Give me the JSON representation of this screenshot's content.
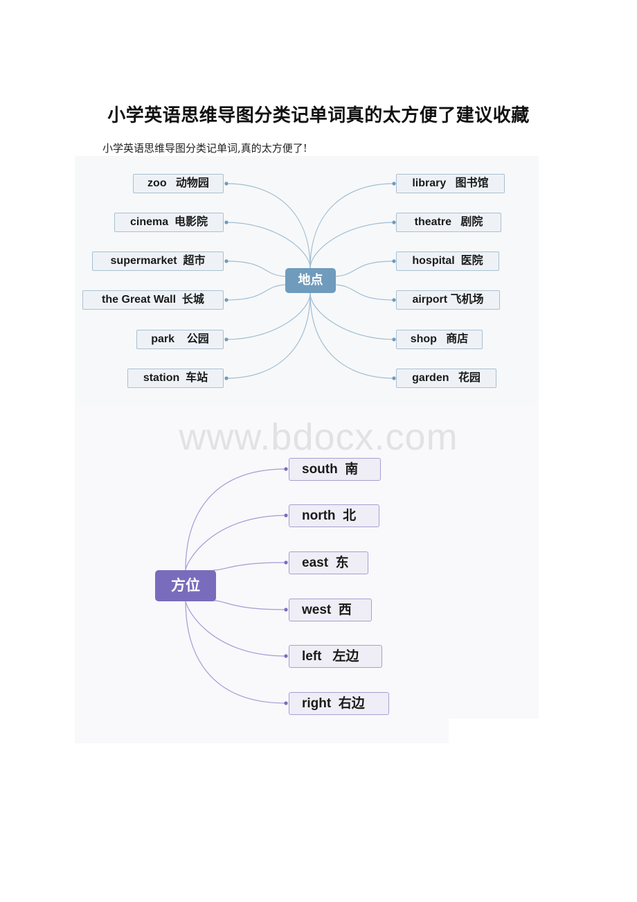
{
  "document": {
    "title": "小学英语思维导图分类记单词真的太方便了建议收藏",
    "subtitle": "小学英语思维导图分类记单词,真的太方便了!",
    "watermark": "www.bdocx.com"
  },
  "colors": {
    "place_accent": "#6f9bbd",
    "place_line": "#9fbdd3",
    "direction_accent": "#7a6cbc",
    "direction_line": "#a49bd3"
  },
  "mindmap_places": {
    "center": "地点",
    "left_branches": [
      {
        "en": "zoo",
        "zh": "动物园",
        "label": "zoo   动物园"
      },
      {
        "en": "cinema",
        "zh": "电影院",
        "label": "cinema  电影院"
      },
      {
        "en": "supermarket",
        "zh": "超市",
        "label": "supermarket  超市"
      },
      {
        "en": "the Great Wall",
        "zh": "长城",
        "label": "the Great Wall  长城"
      },
      {
        "en": "park",
        "zh": "公园",
        "label": "park    公园"
      },
      {
        "en": "station",
        "zh": "车站",
        "label": "station  车站"
      }
    ],
    "right_branches": [
      {
        "en": "library",
        "zh": "图书馆",
        "label": "library   图书馆"
      },
      {
        "en": "theatre",
        "zh": "剧院",
        "label": "theatre   剧院"
      },
      {
        "en": "hospital",
        "zh": "医院",
        "label": "hospital  医院"
      },
      {
        "en": "airport",
        "zh": "飞机场",
        "label": "airport 飞机场"
      },
      {
        "en": "shop",
        "zh": "商店",
        "label": "shop   商店"
      },
      {
        "en": "garden",
        "zh": "花园",
        "label": "garden   花园"
      }
    ]
  },
  "mindmap_directions": {
    "center": "方位",
    "branches": [
      {
        "en": "south",
        "zh": "南",
        "label": "south  南"
      },
      {
        "en": "north",
        "zh": "北",
        "label": "north  北"
      },
      {
        "en": "east",
        "zh": "东",
        "label": "east  东"
      },
      {
        "en": "west",
        "zh": "西",
        "label": "west  西"
      },
      {
        "en": "left",
        "zh": "左边",
        "label": "left   左边"
      },
      {
        "en": "right",
        "zh": "右边",
        "label": "right  右边"
      }
    ]
  }
}
